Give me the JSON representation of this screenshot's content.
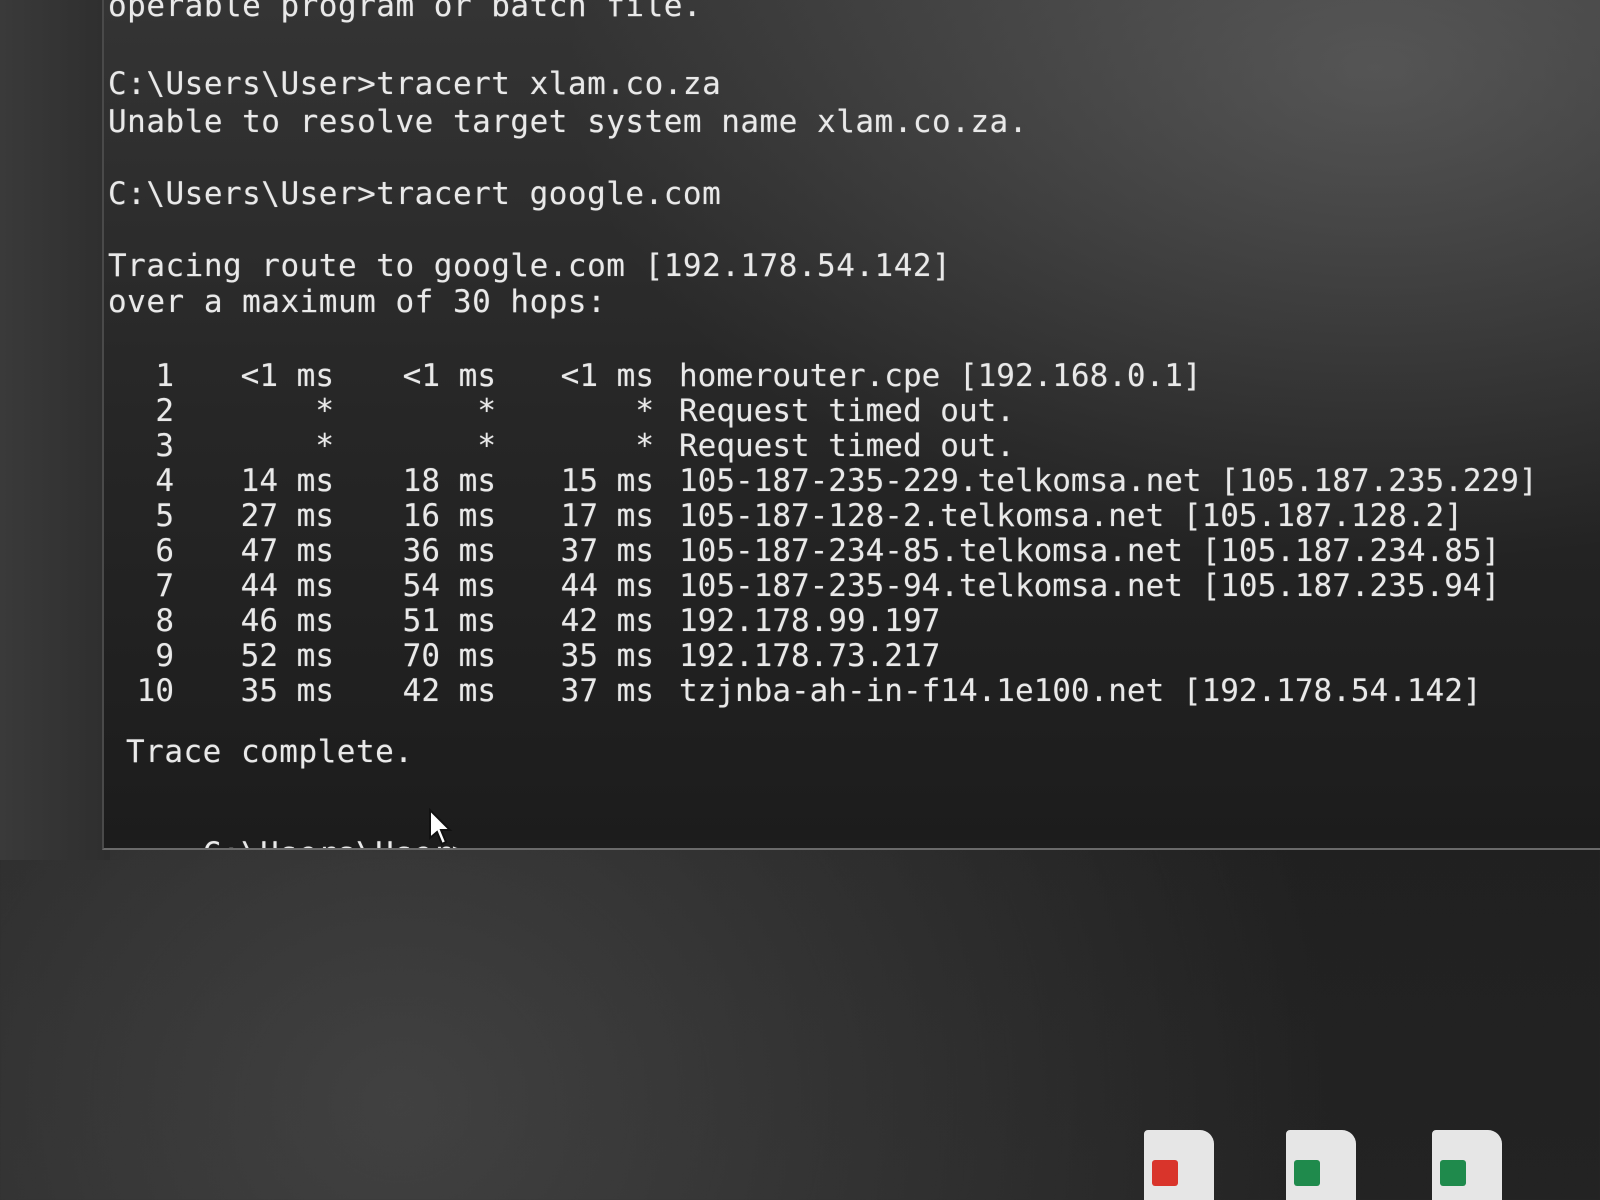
{
  "console": {
    "lines": [
      "operable program or batch file.",
      "C:\\Users\\User>tracert xlam.co.za",
      "Unable to resolve target system name xlam.co.za.",
      "C:\\Users\\User>tracert google.com",
      "Tracing route to google.com [192.178.54.142]",
      "over a maximum of 30 hops:"
    ],
    "hops": [
      {
        "num": "1",
        "t1": "<1 ms",
        "t2": "<1 ms",
        "t3": "<1 ms",
        "host": "homerouter.cpe [192.168.0.1]"
      },
      {
        "num": "2",
        "t1": "*",
        "t2": "*",
        "t3": "*",
        "host": "Request timed out."
      },
      {
        "num": "3",
        "t1": "*",
        "t2": "*",
        "t3": "*",
        "host": "Request timed out."
      },
      {
        "num": "4",
        "t1": "14 ms",
        "t2": "18 ms",
        "t3": "15 ms",
        "host": "105-187-235-229.telkomsa.net [105.187.235.229]"
      },
      {
        "num": "5",
        "t1": "27 ms",
        "t2": "16 ms",
        "t3": "17 ms",
        "host": "105-187-128-2.telkomsa.net [105.187.128.2]"
      },
      {
        "num": "6",
        "t1": "47 ms",
        "t2": "36 ms",
        "t3": "37 ms",
        "host": "105-187-234-85.telkomsa.net [105.187.234.85]"
      },
      {
        "num": "7",
        "t1": "44 ms",
        "t2": "54 ms",
        "t3": "44 ms",
        "host": "105-187-235-94.telkomsa.net [105.187.235.94]"
      },
      {
        "num": "8",
        "t1": "46 ms",
        "t2": "51 ms",
        "t3": "42 ms",
        "host": "192.178.99.197"
      },
      {
        "num": "9",
        "t1": "52 ms",
        "t2": "70 ms",
        "t3": "35 ms",
        "host": "192.178.73.217"
      },
      {
        "num": "10",
        "t1": "35 ms",
        "t2": "42 ms",
        "t3": "37 ms",
        "host": "tzjnba-ah-in-f14.1e100.net [192.178.54.142]"
      }
    ],
    "trace_complete": "Trace complete.",
    "prompt": "C:\\Users\\User>"
  },
  "icons": {
    "mouse": "arrow-pointer",
    "taskbar": [
      "pdf-file-icon",
      "excel-file-icon",
      "excel-file-icon"
    ]
  },
  "colors": {
    "text": "#e9e9e9",
    "console_bg": "#262626",
    "pdf_badge": "#d9342b",
    "excel_badge": "#1f8a4c"
  }
}
